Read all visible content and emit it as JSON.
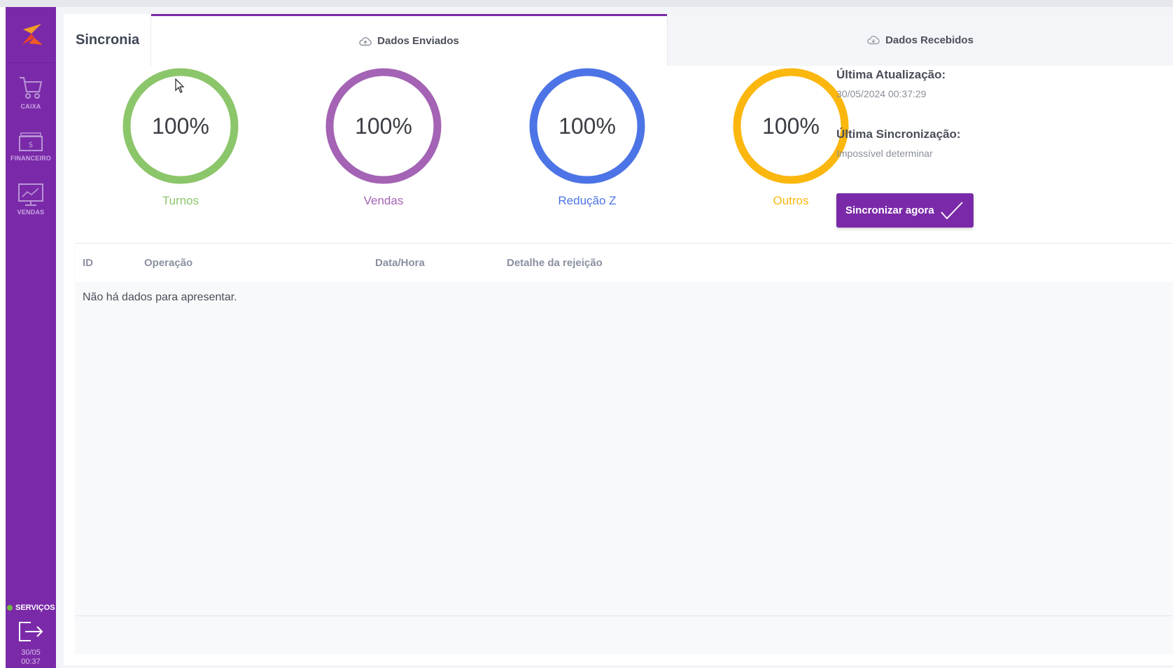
{
  "sidebar": {
    "items": [
      {
        "label": "CAIXA",
        "icon": "cart-icon"
      },
      {
        "label": "FINANCEIRO",
        "icon": "cash-icon"
      },
      {
        "label": "VENDAS",
        "icon": "chart-monitor-icon"
      }
    ],
    "services_label": "SERVIÇOS",
    "services_status_color": "#6dbb3f",
    "clock": {
      "date": "30/05",
      "time": "00:37"
    }
  },
  "header": {
    "title": "Sincronia",
    "tabs": [
      {
        "label": "Dados Enviados",
        "icon": "cloud-upload-icon",
        "active": true
      },
      {
        "label": "Dados Recebidos",
        "icon": "cloud-download-icon",
        "active": false
      }
    ]
  },
  "gauges": [
    {
      "label": "Turnos",
      "percent": 100,
      "text": "100%",
      "color": "#8cc66a"
    },
    {
      "label": "Vendas",
      "percent": 100,
      "text": "100%",
      "color": "#a463b4"
    },
    {
      "label": "Redução Z",
      "percent": 100,
      "text": "100%",
      "color": "#4d74e6"
    },
    {
      "label": "Outros",
      "percent": 100,
      "text": "100%",
      "color": "#fbb70e"
    }
  ],
  "info": {
    "last_update_label": "Última Atualização:",
    "last_update_value": "30/05/2024 00:37:29",
    "last_sync_label": "Última Sincronização:",
    "last_sync_value": "Impossível determinar"
  },
  "sync_button": {
    "label": "Sincronizar agora"
  },
  "table": {
    "columns": [
      "ID",
      "Operação",
      "Data/Hora",
      "Detalhe da rejeição"
    ],
    "empty_message": "Não há dados para apresentar."
  },
  "colors": {
    "brand": "#7a2aa8"
  }
}
